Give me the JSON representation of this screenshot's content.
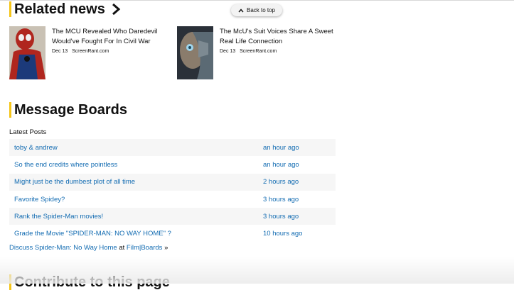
{
  "back_to_top": {
    "label": "Back to top",
    "icon": "chevron-up-icon"
  },
  "related_news": {
    "heading": "Related news",
    "icon": "chevron-right-icon",
    "items": [
      {
        "title": "The MCU Revealed Who Daredevil Would've Fought For In Civil War",
        "date": "Dec 13",
        "source": "ScreenRant.com",
        "thumb_color": "#b0261e"
      },
      {
        "title": "The McU's Suit Voices Share A Sweet Real Life Connection",
        "date": "Dec 13",
        "source": "ScreenRant.com",
        "thumb_color": "#3a4650"
      }
    ]
  },
  "message_boards": {
    "heading": "Message Boards",
    "latest_label": "Latest Posts",
    "posts": [
      {
        "title": "toby & andrew",
        "time": "an hour ago"
      },
      {
        "title": "So the end credits where pointless",
        "time": "an hour ago"
      },
      {
        "title": "Might just be the dumbest plot of all time",
        "time": "2 hours ago"
      },
      {
        "title": "Favorite Spidey?",
        "time": "3 hours ago"
      },
      {
        "title": "Rank the Spider-Man movies!",
        "time": "3 hours ago"
      },
      {
        "title": "Grade the Movie \"SPIDER-MAN: NO WAY HOME\" ?",
        "time": "10 hours ago"
      }
    ],
    "discuss_link": "Discuss Spider-Man: No Way Home",
    "discuss_at": "at",
    "boards_link": "Film|Boards",
    "boards_suffix": "»"
  },
  "contribute": {
    "heading": "Contribute to this page"
  },
  "colors": {
    "accent": "#f5c518",
    "link": "#136cb2",
    "row_alt": "#f6f6f6"
  }
}
